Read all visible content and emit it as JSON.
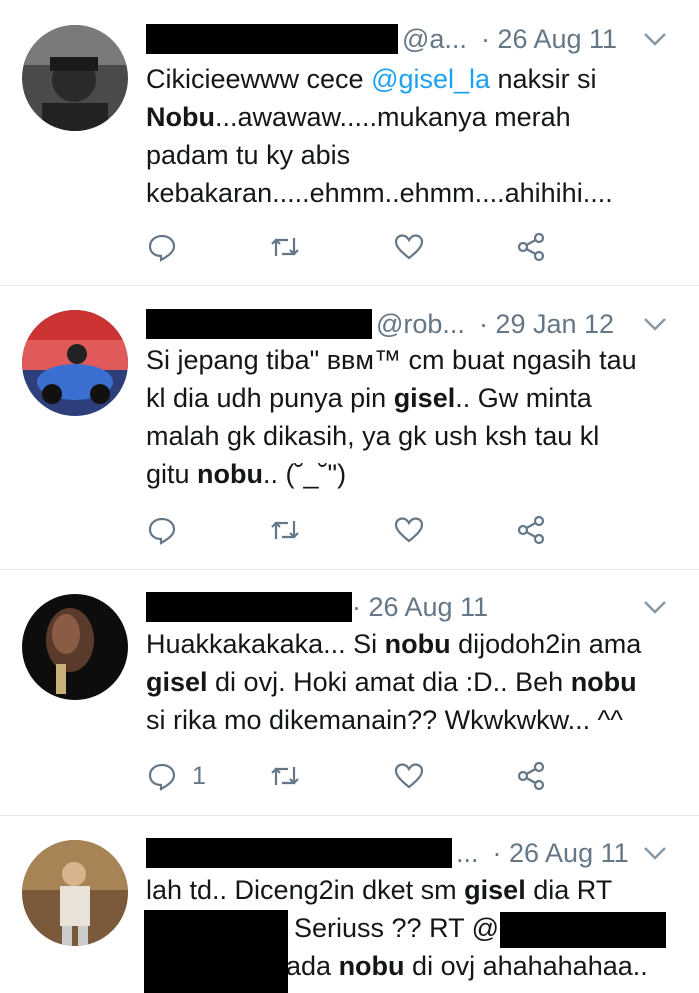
{
  "tweets": [
    {
      "handle": "@a...",
      "date": "· 26 Aug 11",
      "segments": [
        {
          "t": "Cikicieewww cece "
        },
        {
          "t": "@gisel_la",
          "k": "mention"
        },
        {
          "t": " naksir si\n"
        },
        {
          "t": "Nobu",
          "k": "bold"
        },
        {
          "t": "...awawaw.....mukanya merah\npadam tu ky abis\nkebakaran.....ehmm..ehmm....ahihihi...."
        }
      ],
      "reply_count": ""
    },
    {
      "handle": "@rob...",
      "date": "· 29 Jan 12",
      "segments": [
        {
          "t": "Si jepang tiba\" ʙʙᴍ™ cm buat ngasih tau\nkl dia udh punya pin "
        },
        {
          "t": "gisel",
          "k": "bold"
        },
        {
          "t": ".. Gw minta\nmalah gk dikasih, ya gk ush ksh tau kl\ngitu "
        },
        {
          "t": "nobu",
          "k": "bold"
        },
        {
          "t": ".. (˘_˘\")"
        }
      ],
      "reply_count": ""
    },
    {
      "handle": "",
      "date": "· 26 Aug 11",
      "segments": [
        {
          "t": "Huakkakakaka... Si "
        },
        {
          "t": "nobu",
          "k": "bold"
        },
        {
          "t": " dijodoh2in ama\n"
        },
        {
          "t": "gisel",
          "k": "bold"
        },
        {
          "t": " di ovj. Hoki amat dia :D.. Beh "
        },
        {
          "t": "nobu",
          "k": "bold"
        },
        {
          "t": "\nsi rika mo dikemanain?? Wkwkwkw... ^^"
        }
      ],
      "reply_count": "1"
    },
    {
      "handle": "...",
      "date": "· 26 Aug 11",
      "lines": [
        {
          "segments": [
            {
              "t": "lah td.. Diceng2in dket sm "
            },
            {
              "t": "gisel",
              "k": "bold"
            },
            {
              "t": " dia RT"
            }
          ]
        },
        {
          "segments": [
            {
              "t": "Seriuss ?? RT @"
            }
          ]
        },
        {
          "segments": [
            {
              "t": "ada "
            },
            {
              "t": "nobu",
              "k": "bold"
            },
            {
              "t": " di ovj ahahahahaa.."
            }
          ]
        }
      ]
    }
  ],
  "icons": {
    "reply": "reply-icon",
    "retweet": "retweet-icon",
    "like": "heart-icon",
    "share": "share-icon",
    "menu": "chevron-down-icon"
  },
  "colors": {
    "text": "#14171a",
    "secondary": "#657786",
    "mention": "#1da1f2",
    "divider": "#e1e8ed"
  }
}
